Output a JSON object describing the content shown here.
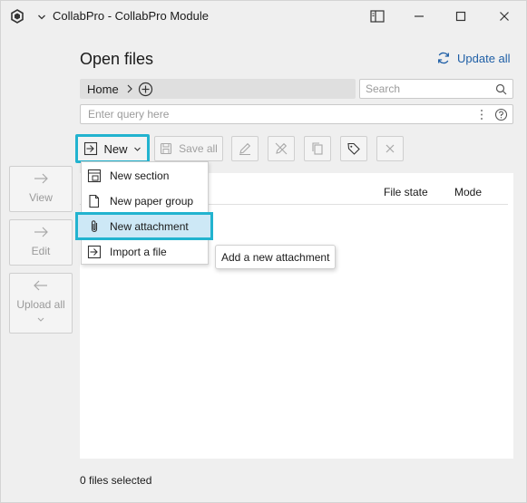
{
  "window": {
    "title": "CollabPro - CollabPro Module"
  },
  "sidebar": {
    "view_label": "View",
    "edit_label": "Edit",
    "upload_all_label": "Upload all"
  },
  "header": {
    "title": "Open files",
    "update_all_label": "Update all"
  },
  "breadcrumb": {
    "home_label": "Home"
  },
  "search": {
    "placeholder": "Search",
    "value": ""
  },
  "query": {
    "placeholder": "Enter query here",
    "value": ""
  },
  "toolbar": {
    "new_label": "New",
    "save_all_label": "Save all"
  },
  "table": {
    "columns": [
      "File state",
      "Mode"
    ]
  },
  "new_menu": {
    "items": [
      {
        "label": "New section",
        "icon": "section-icon"
      },
      {
        "label": "New paper group",
        "icon": "paper-group-icon"
      },
      {
        "label": "New attachment",
        "icon": "paperclip-icon"
      },
      {
        "label": "Import a file",
        "icon": "import-icon"
      }
    ],
    "active_index": 2
  },
  "tooltip": {
    "text": "Add a new attachment"
  },
  "status": {
    "selected_text": "0 files selected"
  },
  "colors": {
    "accent_highlight": "#22b3cf",
    "link_blue": "#1f5fa6",
    "menu_selected_bg": "#cde8f6"
  }
}
